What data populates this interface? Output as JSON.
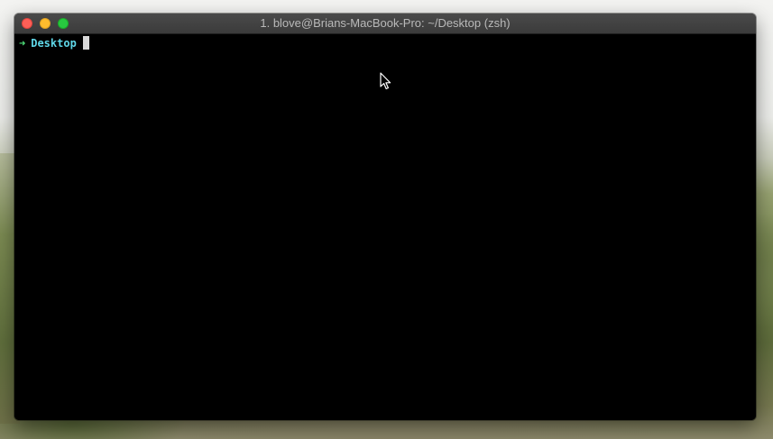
{
  "window": {
    "title": "1. blove@Brians-MacBook-Pro: ~/Desktop (zsh)",
    "controls": [
      "close",
      "minimize",
      "zoom"
    ]
  },
  "terminal": {
    "prompt_symbol": "➜",
    "current_directory": "Desktop",
    "input": ""
  },
  "colors": {
    "close": "#fe5f57",
    "minimize": "#febc2e",
    "zoom": "#28c840",
    "prompt_arrow": "#4fe07a",
    "directory": "#5fd7e8",
    "terminal_bg": "#000000"
  },
  "icons": {
    "mouse_pointer": "arrow-pointer-icon"
  }
}
